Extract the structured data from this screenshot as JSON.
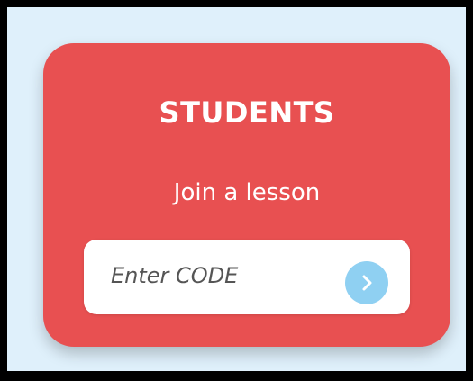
{
  "students_panel": {
    "heading": "STUDENTS",
    "subheading": "Join a lesson",
    "code_input": {
      "placeholder": "Enter CODE",
      "value": ""
    },
    "submit_icon": "chevron-right-icon"
  },
  "colors": {
    "background": "#dff0fb",
    "card": "#e85051",
    "button": "#8fd0f2",
    "text": "#ffffff"
  }
}
